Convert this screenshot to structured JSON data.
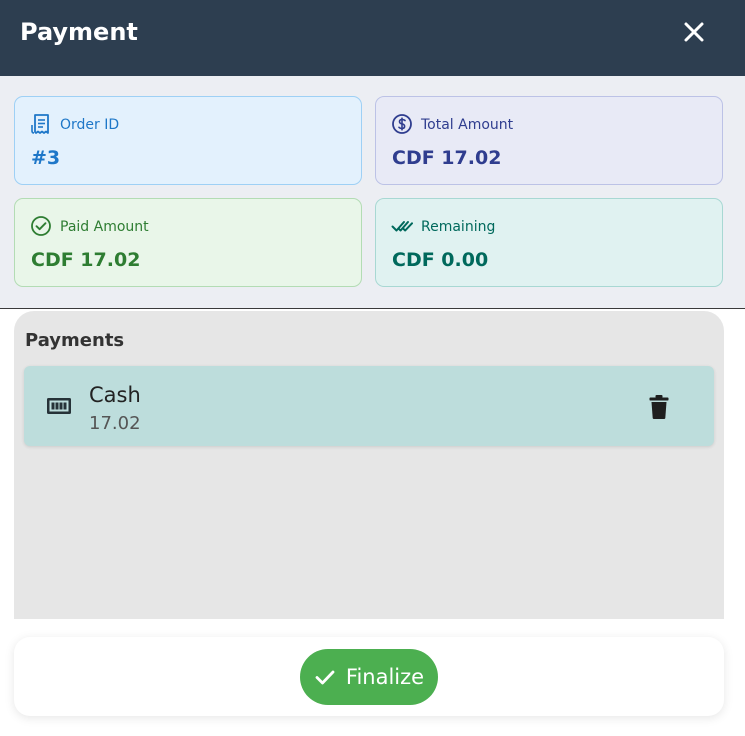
{
  "header": {
    "title": "Payment",
    "close_icon": "close-icon"
  },
  "summary": {
    "order": {
      "label": "Order ID",
      "value": "#3",
      "icon": "receipt-icon",
      "color": "#1e77c8"
    },
    "total": {
      "label": "Total Amount",
      "value": "CDF 17.02",
      "icon": "dollar-circle-icon",
      "color": "#2f3d8f"
    },
    "paid": {
      "label": "Paid Amount",
      "value": "CDF 17.02",
      "icon": "check-circle-icon",
      "color": "#2e7d32"
    },
    "remaining": {
      "label": "Remaining",
      "value": "CDF 0.00",
      "icon": "double-check-icon",
      "color": "#00695c"
    }
  },
  "payments": {
    "title": "Payments",
    "items": [
      {
        "method": "Cash",
        "amount": "17.02",
        "icon": "cash-icon",
        "delete_icon": "trash-icon"
      }
    ]
  },
  "footer": {
    "finalize_label": "Finalize",
    "finalize_icon": "check-icon",
    "finalize_color": "#4caf50"
  },
  "colors": {
    "header_bg": "#2d3e50",
    "panel_bg": "#e6e6e6",
    "row_bg": "#bddddc"
  }
}
